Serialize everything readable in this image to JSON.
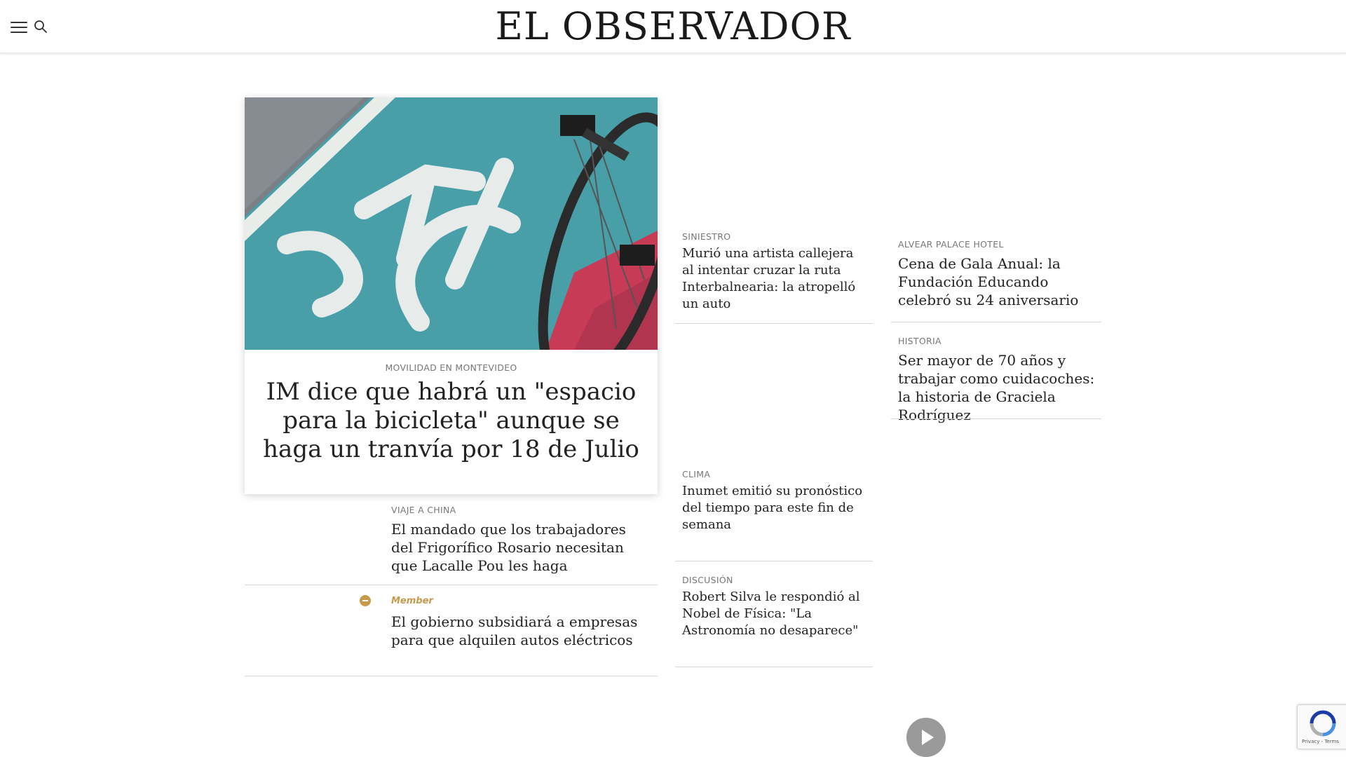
{
  "header": {
    "logo": "EL OBSERVADOR",
    "menu_icon": "hamburger-menu-icon",
    "search_icon": "search-icon"
  },
  "hero": {
    "image": "bike-lane-photo",
    "kicker": "MOVILIDAD EN MONTEVIDEO",
    "title": "IM dice que habrá un \"espacio para la bicicleta\" aunque se haga un tranvía por 18 de Julio"
  },
  "left_column": [
    {
      "kicker": "VIAJE A CHINA",
      "title": "El mandado que los trabajadores del Frigorífico Rosario necesitan que Lacalle Pou les haga"
    },
    {
      "badge": "Member",
      "title": "El gobierno subsidiará a empresas para que alquilen autos eléctricos"
    }
  ],
  "middle_column": [
    {
      "kicker": "SINIESTRO",
      "title": "Murió una artista callejera al intentar cruzar la ruta Interbalnearia: la atropelló un auto"
    },
    {
      "kicker": "CLIMA",
      "title": "Inumet emitió su pronóstico del tiempo para este fin de semana"
    },
    {
      "kicker": "DISCUSIÓN",
      "title": "Robert Silva le respondió al Nobel de Física: \"La Astronomía no desaparece\""
    }
  ],
  "right_column": [
    {
      "kicker": "ALVEAR PALACE HOTEL",
      "title": "Cena de Gala Anual: la Fundación Educando celebró su 24 aniversario"
    },
    {
      "kicker": "HISTORIA",
      "title": "Ser mayor de 70 años y trabajar como cuidacoches: la historia de Graciela Rodríguez"
    }
  ],
  "widgets": {
    "play_icon": "play-icon",
    "recaptcha_text": "Privacy - Terms"
  },
  "colors": {
    "member_accent": "#c79a4b",
    "bike_lane": "#3aa3ad"
  }
}
